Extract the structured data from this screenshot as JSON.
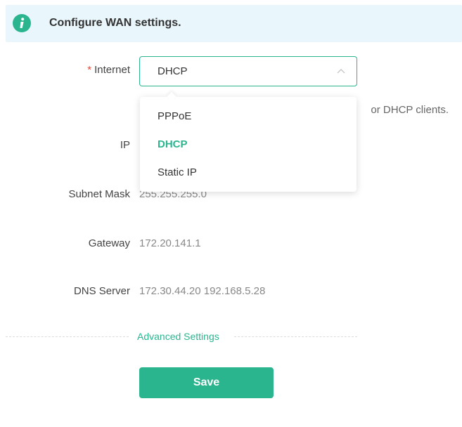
{
  "banner": {
    "icon": "info-icon",
    "title": "Configure WAN settings."
  },
  "form": {
    "internet": {
      "required_mark": "*",
      "label": "Internet",
      "value": "DHCP",
      "arrow_icon": "chevron-up-icon",
      "options": [
        "PPPoE",
        "DHCP",
        "Static IP"
      ],
      "selected_option": "DHCP"
    },
    "hint_visible_text": "or DHCP clients.",
    "ip": {
      "label": "IP"
    },
    "subnet_mask": {
      "label": "Subnet Mask",
      "value": "255.255.255.0"
    },
    "gateway": {
      "label": "Gateway",
      "value": "172.20.141.1"
    },
    "dns_server": {
      "label": "DNS Server",
      "value": "172.30.44.20 192.168.5.28"
    }
  },
  "advanced_settings_label": "Advanced Settings",
  "save_label": "Save",
  "colors": {
    "accent": "#2bb58f",
    "banner_bg": "#e9f6fc",
    "required": "#f04134"
  }
}
